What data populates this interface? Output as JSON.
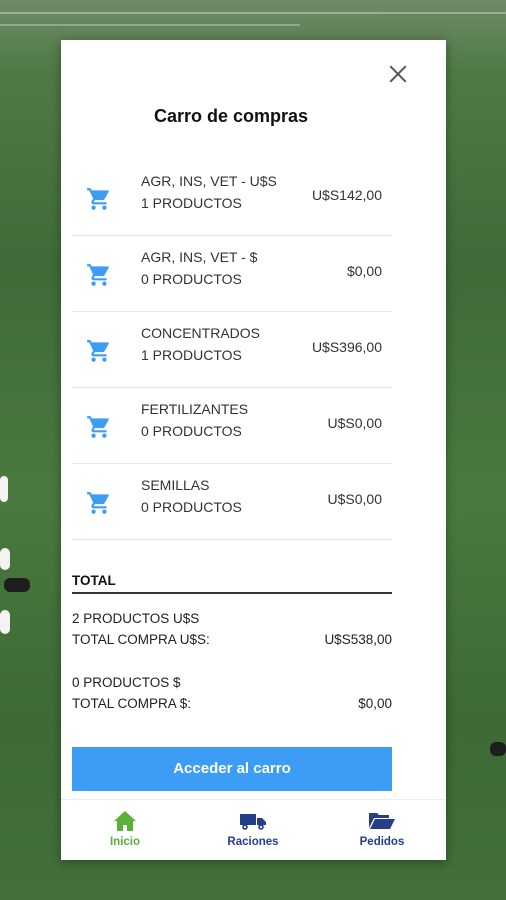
{
  "modal": {
    "title": "Carro de compras",
    "close_icon": "close-icon"
  },
  "items": [
    {
      "name": "AGR, INS, VET - U$S",
      "count": "1 PRODUCTOS",
      "amount": "U$S142,00"
    },
    {
      "name": "AGR, INS, VET - $",
      "count": "0 PRODUCTOS",
      "amount": "$0,00"
    },
    {
      "name": "CONCENTRADOS",
      "count": "1 PRODUCTOS",
      "amount": "U$S396,00"
    },
    {
      "name": "FERTILIZANTES",
      "count": "0 PRODUCTOS",
      "amount": "U$S0,00"
    },
    {
      "name": "SEMILLAS",
      "count": "0 PRODUCTOS",
      "amount": "U$S0,00"
    }
  ],
  "totals": {
    "header": "TOTAL",
    "usd_products": "2 PRODUCTOS U$S",
    "usd_label": "TOTAL COMPRA U$S:",
    "usd_value": "U$S538,00",
    "peso_products": "0 PRODUCTOS $",
    "peso_label": "TOTAL COMPRA $:",
    "peso_value": "$0,00"
  },
  "cta": "Acceder al carro",
  "nav": {
    "inicio": "Inicio",
    "raciones": "Raciones",
    "pedidos": "Pedidos"
  },
  "colors": {
    "accent": "#3d9df5",
    "nav_active": "#5cb038",
    "nav_inactive": "#253e8a"
  }
}
